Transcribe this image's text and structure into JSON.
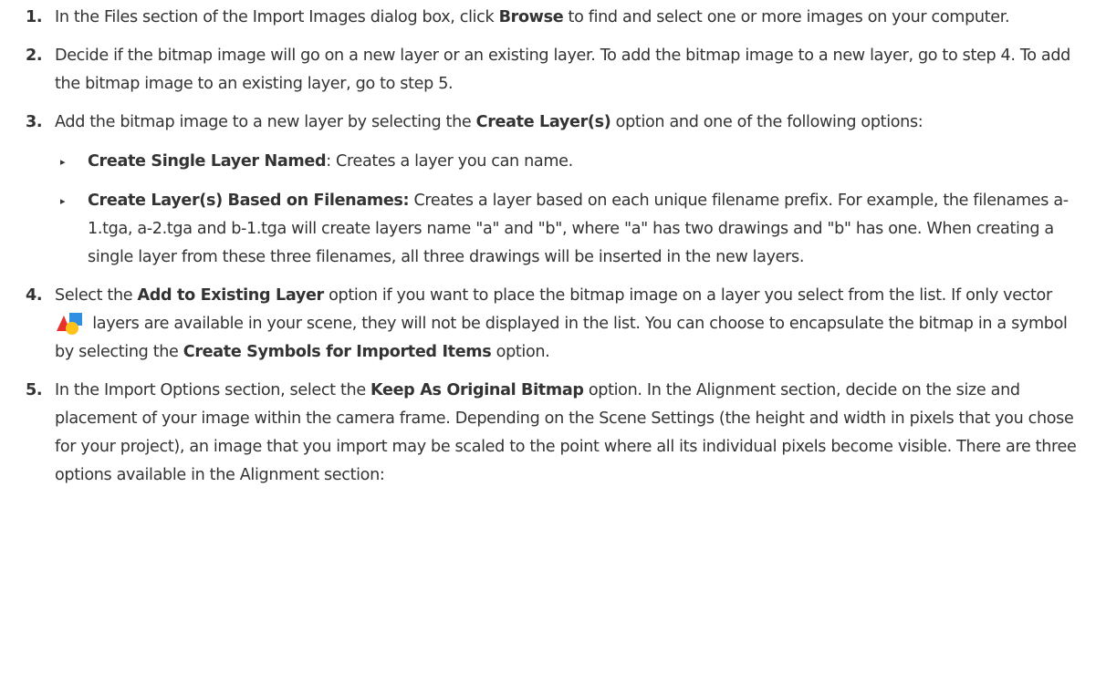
{
  "steps": [
    {
      "num": "1.",
      "text": [
        "In the Files section of the Import Images dialog box, click ",
        "Browse",
        " to find and select one or more images on your computer."
      ]
    },
    {
      "num": "2.",
      "text": "Decide if the bitmap image will go on a new layer or an existing layer. To add the bitmap image to a new layer, go to step 4. To add the bitmap image to an existing layer, go to step 5."
    },
    {
      "num": "3.",
      "text": [
        "Add the bitmap image to a new layer by selecting the ",
        "Create Layer(s)",
        " option and one of the following options:"
      ],
      "sub_items": [
        {
          "bold": "Create Single Layer Named",
          "text": ": Creates a layer you can name."
        },
        {
          "bold": "Create Layer(s) Based on Filenames:",
          "text": " Creates a layer based on each unique filename prefix. For example, the filenames a-1.tga, a-2.tga and b-1.tga will create layers name \"a\" and \"b\", where \"a\" has two drawings and \"b\" has one. When creating a single layer from these three filenames, all three drawings will be inserted in the new layers."
        }
      ]
    },
    {
      "num": "4.",
      "text": [
        "Select the ",
        "Add to Existing Layer",
        " option if you want to place the bitmap image on a layer you select from the list. If only vector ",
        " layers are available in your scene, they will not be displayed in the list. You can choose to encapsulate the bitmap in a symbol by selecting the ",
        "Create Symbols for Imported Items",
        " option."
      ],
      "icon": "vector-layer-icon"
    },
    {
      "num": "5.",
      "text": [
        "In the Import Options section, select the ",
        "Keep As Original Bitmap",
        " option. In the Alignment section, decide on the size and placement of your image within the camera frame. Depending on the Scene Settings (the height and width in pixels that you chose for your project), an image that you import may be scaled to the point where all its individual pixels become visible. There are three options available in the Alignment section:"
      ]
    }
  ],
  "icon_colors": {
    "triangle": "#e8322c",
    "square": "#2f8fe0",
    "circle": "#ffc21a"
  }
}
